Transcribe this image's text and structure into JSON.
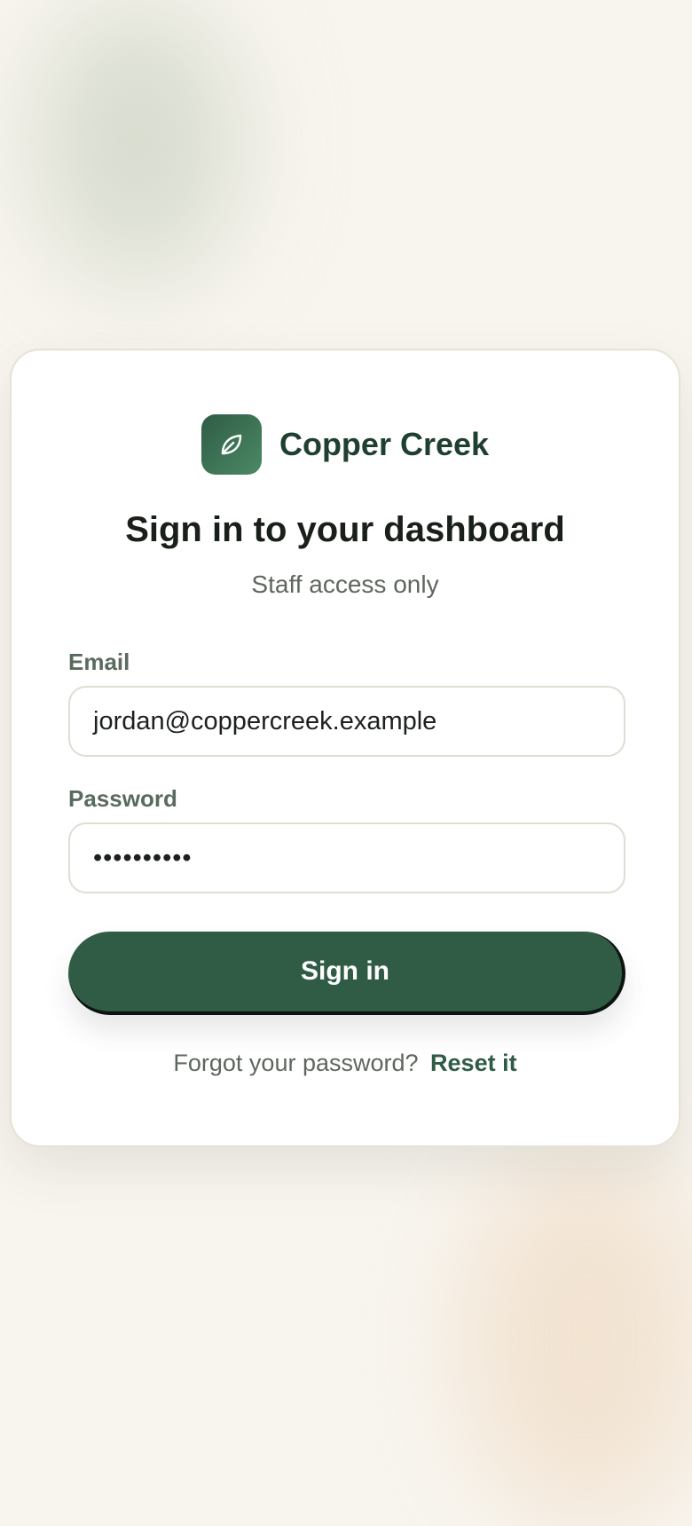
{
  "brand": {
    "name": "Copper Creek",
    "logo_icon": "leaf-icon",
    "color": "#305c45"
  },
  "header": {
    "title": "Sign in to your dashboard",
    "subtitle": "Staff access only"
  },
  "form": {
    "email": {
      "label": "Email",
      "value": "jordan@coppercreek.example"
    },
    "password": {
      "label": "Password",
      "value": "••••••••••"
    },
    "submit_label": "Sign in"
  },
  "footer": {
    "forgot_text": "Forgot your password?",
    "reset_link": "Reset it"
  }
}
